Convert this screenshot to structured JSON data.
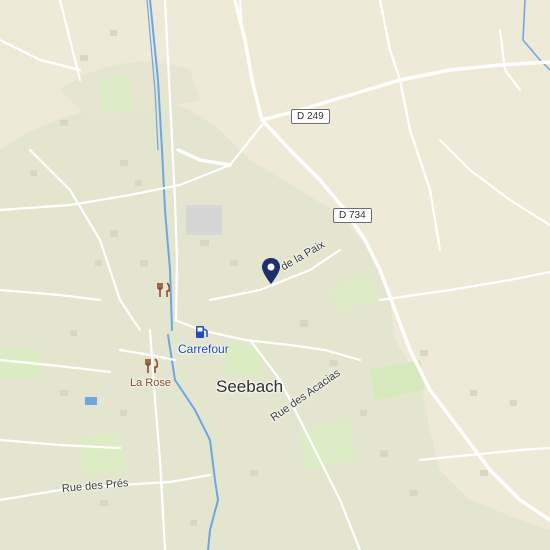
{
  "map": {
    "place_label": "Seebach",
    "road_shields": [
      {
        "id": "d249",
        "text": "D 249"
      },
      {
        "id": "d734",
        "text": "D 734"
      }
    ],
    "streets": {
      "paix": "de la Paix",
      "acacias": "Rue des Acacias",
      "pres": "Rue des Prés"
    },
    "pois": {
      "fuel": {
        "label": "Carrefour",
        "icon": "fuel-station-icon",
        "color": "#1f4db8"
      },
      "restaurant_north": {
        "label": "",
        "icon": "restaurant-icon",
        "color": "#8a4b2d"
      },
      "restaurant": {
        "label": "La Rose",
        "icon": "restaurant-icon",
        "color": "#8a4b2d"
      }
    },
    "marker": {
      "icon": "location-pin-icon",
      "color": "#1d2f6f"
    },
    "colors": {
      "land": "#efe9d7",
      "settlement": "#e3e4cc",
      "park": "#d8ebc0",
      "water": "#6aa7e3",
      "road": "#ffffff"
    }
  }
}
